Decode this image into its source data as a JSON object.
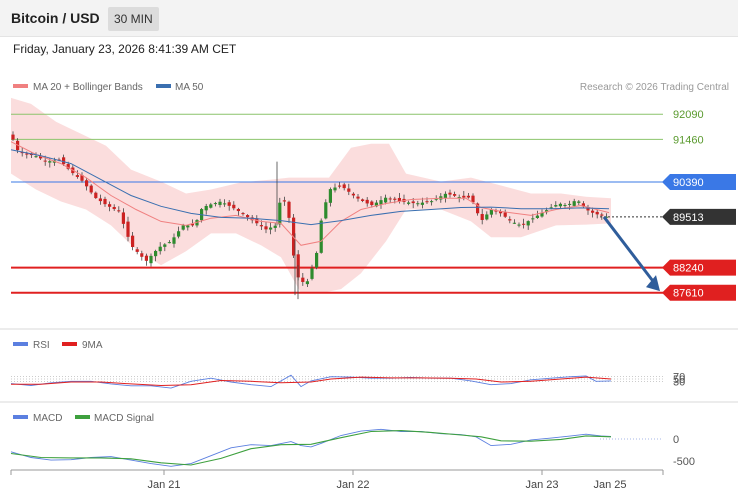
{
  "header": {
    "title": "Bitcoin / USD",
    "interval": "30 MIN"
  },
  "timestamp": "Friday, January 23, 2026 8:41:39 AM CET",
  "copyright": "Research © 2026 Trading Central",
  "legend": {
    "ma20_bb": "MA 20 + Bollinger Bands",
    "ma50": "MA 50"
  },
  "rsi_legend": {
    "rsi": "RSI",
    "ma9": "9MA"
  },
  "macd_legend": {
    "macd": "MACD",
    "signal": "MACD Signal"
  },
  "colors": {
    "bull": "#2e8b2e",
    "bear": "#cc2222",
    "bb_fill": "#fbd9d9",
    "ma20": "#f08080",
    "ma50": "#3a6fb0",
    "resistance_green": "#8cc46c",
    "pivot_blue": "#3a78e6",
    "support_red": "#e02020",
    "last_price": "#333333",
    "arrow": "#2f5d9b",
    "rsi": "#5b7fe0",
    "rsi_ma": "#e02020",
    "macd": "#5b7fe0",
    "macd_signal": "#3ea03e"
  },
  "chart_data": {
    "type": "candlestick",
    "y_range": [
      86800,
      93200
    ],
    "levels": [
      {
        "value": 92090,
        "label": "92090",
        "kind": "resistance"
      },
      {
        "value": 91460,
        "label": "91460",
        "kind": "resistance"
      },
      {
        "value": 90390,
        "label": "90390",
        "kind": "pivot"
      },
      {
        "value": 89513,
        "label": "89513",
        "kind": "last"
      },
      {
        "value": 88240,
        "label": "88240",
        "kind": "support"
      },
      {
        "value": 87610,
        "label": "87610",
        "kind": "support"
      }
    ],
    "x_ticks": [
      "Jan 21",
      "Jan 22",
      "Jan 23",
      "Jan 25"
    ],
    "price_path": [
      [
        0,
        91580
      ],
      [
        6,
        91200
      ],
      [
        12,
        91100
      ],
      [
        24,
        91050
      ],
      [
        36,
        90900
      ],
      [
        48,
        90950
      ],
      [
        60,
        90650
      ],
      [
        72,
        90400
      ],
      [
        84,
        90000
      ],
      [
        96,
        89800
      ],
      [
        108,
        89650
      ],
      [
        120,
        88800
      ],
      [
        135,
        88400
      ],
      [
        148,
        88750
      ],
      [
        160,
        88900
      ],
      [
        172,
        89300
      ],
      [
        184,
        89300
      ],
      [
        190,
        89700
      ],
      [
        196,
        89800
      ],
      [
        210,
        89900
      ],
      [
        225,
        89700
      ],
      [
        240,
        89450
      ],
      [
        255,
        89200
      ],
      [
        265,
        89300
      ],
      [
        269,
        89900
      ],
      [
        276,
        89900
      ],
      [
        285,
        88050
      ],
      [
        295,
        87800
      ],
      [
        305,
        88500
      ],
      [
        310,
        89400
      ],
      [
        318,
        90200
      ],
      [
        330,
        90300
      ],
      [
        345,
        90000
      ],
      [
        360,
        89800
      ],
      [
        375,
        90000
      ],
      [
        390,
        89900
      ],
      [
        405,
        89850
      ],
      [
        420,
        89900
      ],
      [
        435,
        90100
      ],
      [
        450,
        90000
      ],
      [
        460,
        90000
      ],
      [
        470,
        89400
      ],
      [
        480,
        89700
      ],
      [
        490,
        89600
      ],
      [
        500,
        89400
      ],
      [
        510,
        89300
      ],
      [
        520,
        89450
      ],
      [
        530,
        89600
      ],
      [
        540,
        89750
      ],
      [
        548,
        89850
      ],
      [
        556,
        89800
      ],
      [
        566,
        89950
      ],
      [
        575,
        89700
      ],
      [
        583,
        89600
      ],
      [
        590,
        89550
      ],
      [
        596,
        89513
      ]
    ],
    "ma20_path": [
      [
        0,
        91400
      ],
      [
        25,
        91080
      ],
      [
        50,
        90850
      ],
      [
        75,
        90500
      ],
      [
        100,
        90050
      ],
      [
        125,
        89700
      ],
      [
        150,
        89400
      ],
      [
        175,
        89300
      ],
      [
        200,
        89480
      ],
      [
        225,
        89550
      ],
      [
        250,
        89400
      ],
      [
        270,
        89350
      ],
      [
        290,
        88800
      ],
      [
        310,
        88900
      ],
      [
        330,
        89400
      ],
      [
        350,
        89700
      ],
      [
        375,
        89850
      ],
      [
        400,
        89950
      ],
      [
        430,
        89980
      ],
      [
        455,
        89980
      ],
      [
        470,
        89750
      ],
      [
        490,
        89650
      ],
      [
        520,
        89550
      ],
      [
        545,
        89700
      ],
      [
        570,
        89800
      ],
      [
        598,
        89620
      ]
    ],
    "ma50_path": [
      [
        0,
        91200
      ],
      [
        30,
        91050
      ],
      [
        60,
        90850
      ],
      [
        90,
        90450
      ],
      [
        120,
        90050
      ],
      [
        150,
        89780
      ],
      [
        180,
        89600
      ],
      [
        210,
        89500
      ],
      [
        240,
        89480
      ],
      [
        270,
        89420
      ],
      [
        300,
        89320
      ],
      [
        330,
        89420
      ],
      [
        360,
        89550
      ],
      [
        390,
        89650
      ],
      [
        420,
        89700
      ],
      [
        450,
        89750
      ],
      [
        480,
        89760
      ],
      [
        510,
        89720
      ],
      [
        540,
        89720
      ],
      [
        570,
        89740
      ],
      [
        598,
        89720
      ]
    ],
    "bb_upper_path": [
      [
        0,
        92500
      ],
      [
        20,
        92350
      ],
      [
        45,
        91900
      ],
      [
        70,
        91600
      ],
      [
        95,
        91300
      ],
      [
        120,
        90700
      ],
      [
        150,
        90400
      ],
      [
        175,
        90100
      ],
      [
        200,
        90200
      ],
      [
        230,
        90380
      ],
      [
        260,
        90450
      ],
      [
        278,
        90500
      ],
      [
        300,
        90500
      ],
      [
        318,
        90500
      ],
      [
        340,
        91250
      ],
      [
        360,
        91350
      ],
      [
        378,
        91350
      ],
      [
        395,
        90600
      ],
      [
        430,
        90400
      ],
      [
        460,
        90500
      ],
      [
        490,
        90300
      ],
      [
        520,
        90100
      ],
      [
        550,
        90100
      ],
      [
        575,
        90020
      ],
      [
        600,
        89980
      ]
    ],
    "bb_lower_path": [
      [
        0,
        90600
      ],
      [
        25,
        90200
      ],
      [
        50,
        89900
      ],
      [
        75,
        89700
      ],
      [
        100,
        89300
      ],
      [
        125,
        88700
      ],
      [
        150,
        88300
      ],
      [
        175,
        88650
      ],
      [
        200,
        89100
      ],
      [
        225,
        89100
      ],
      [
        250,
        88800
      ],
      [
        270,
        88500
      ],
      [
        290,
        87600
      ],
      [
        310,
        87600
      ],
      [
        330,
        87700
      ],
      [
        350,
        88100
      ],
      [
        375,
        88900
      ],
      [
        395,
        89700
      ],
      [
        430,
        89700
      ],
      [
        460,
        89400
      ],
      [
        480,
        89000
      ],
      [
        510,
        89000
      ],
      [
        545,
        89300
      ],
      [
        575,
        89320
      ],
      [
        600,
        89350
      ]
    ],
    "forecast": {
      "from": [
        604,
        89513
      ],
      "to": [
        660,
        87650
      ]
    },
    "rsi": {
      "range": [
        0,
        100
      ],
      "levels": [
        70,
        50,
        30
      ],
      "path": [
        [
          0,
          38
        ],
        [
          20,
          33
        ],
        [
          40,
          40
        ],
        [
          60,
          44
        ],
        [
          80,
          44
        ],
        [
          100,
          37
        ],
        [
          120,
          32
        ],
        [
          140,
          32
        ],
        [
          160,
          26
        ],
        [
          180,
          44
        ],
        [
          200,
          52
        ],
        [
          220,
          42
        ],
        [
          240,
          35
        ],
        [
          260,
          30
        ],
        [
          280,
          60
        ],
        [
          290,
          30
        ],
        [
          300,
          45
        ],
        [
          320,
          56
        ],
        [
          340,
          55
        ],
        [
          360,
          52
        ],
        [
          380,
          52
        ],
        [
          400,
          54
        ],
        [
          420,
          52
        ],
        [
          440,
          52
        ],
        [
          460,
          45
        ],
        [
          480,
          35
        ],
        [
          500,
          38
        ],
        [
          520,
          48
        ],
        [
          540,
          52
        ],
        [
          560,
          56
        ],
        [
          575,
          58
        ],
        [
          585,
          44
        ],
        [
          600,
          45
        ]
      ],
      "ma9_path": [
        [
          0,
          36
        ],
        [
          30,
          36
        ],
        [
          60,
          42
        ],
        [
          90,
          42
        ],
        [
          120,
          37
        ],
        [
          150,
          33
        ],
        [
          180,
          35
        ],
        [
          210,
          46
        ],
        [
          240,
          44
        ],
        [
          270,
          40
        ],
        [
          300,
          42
        ],
        [
          320,
          50
        ],
        [
          350,
          55
        ],
        [
          380,
          53
        ],
        [
          410,
          53
        ],
        [
          440,
          52
        ],
        [
          465,
          50
        ],
        [
          490,
          42
        ],
        [
          520,
          44
        ],
        [
          550,
          50
        ],
        [
          575,
          55
        ],
        [
          600,
          50
        ]
      ]
    },
    "macd": {
      "ticks": [
        0,
        -500
      ],
      "macd_path": [
        [
          0,
          -290
        ],
        [
          20,
          -420
        ],
        [
          40,
          -480
        ],
        [
          60,
          -470
        ],
        [
          80,
          -420
        ],
        [
          100,
          -400
        ],
        [
          120,
          -480
        ],
        [
          140,
          -560
        ],
        [
          160,
          -620
        ],
        [
          180,
          -560
        ],
        [
          200,
          -380
        ],
        [
          220,
          -200
        ],
        [
          240,
          -130
        ],
        [
          260,
          -150
        ],
        [
          280,
          -60
        ],
        [
          290,
          -150
        ],
        [
          300,
          -180
        ],
        [
          310,
          -100
        ],
        [
          330,
          80
        ],
        [
          350,
          180
        ],
        [
          370,
          220
        ],
        [
          390,
          170
        ],
        [
          410,
          170
        ],
        [
          430,
          120
        ],
        [
          450,
          100
        ],
        [
          465,
          50
        ],
        [
          480,
          -150
        ],
        [
          500,
          -120
        ],
        [
          520,
          -20
        ],
        [
          540,
          20
        ],
        [
          560,
          70
        ],
        [
          575,
          110
        ],
        [
          590,
          70
        ],
        [
          600,
          60
        ]
      ],
      "signal_path": [
        [
          0,
          -330
        ],
        [
          30,
          -420
        ],
        [
          60,
          -430
        ],
        [
          90,
          -430
        ],
        [
          120,
          -450
        ],
        [
          150,
          -540
        ],
        [
          180,
          -590
        ],
        [
          210,
          -440
        ],
        [
          240,
          -220
        ],
        [
          270,
          -130
        ],
        [
          300,
          -120
        ],
        [
          330,
          30
        ],
        [
          360,
          170
        ],
        [
          390,
          190
        ],
        [
          420,
          150
        ],
        [
          450,
          90
        ],
        [
          470,
          50
        ],
        [
          490,
          -40
        ],
        [
          520,
          -50
        ],
        [
          550,
          -10
        ],
        [
          575,
          70
        ],
        [
          600,
          50
        ]
      ]
    }
  }
}
